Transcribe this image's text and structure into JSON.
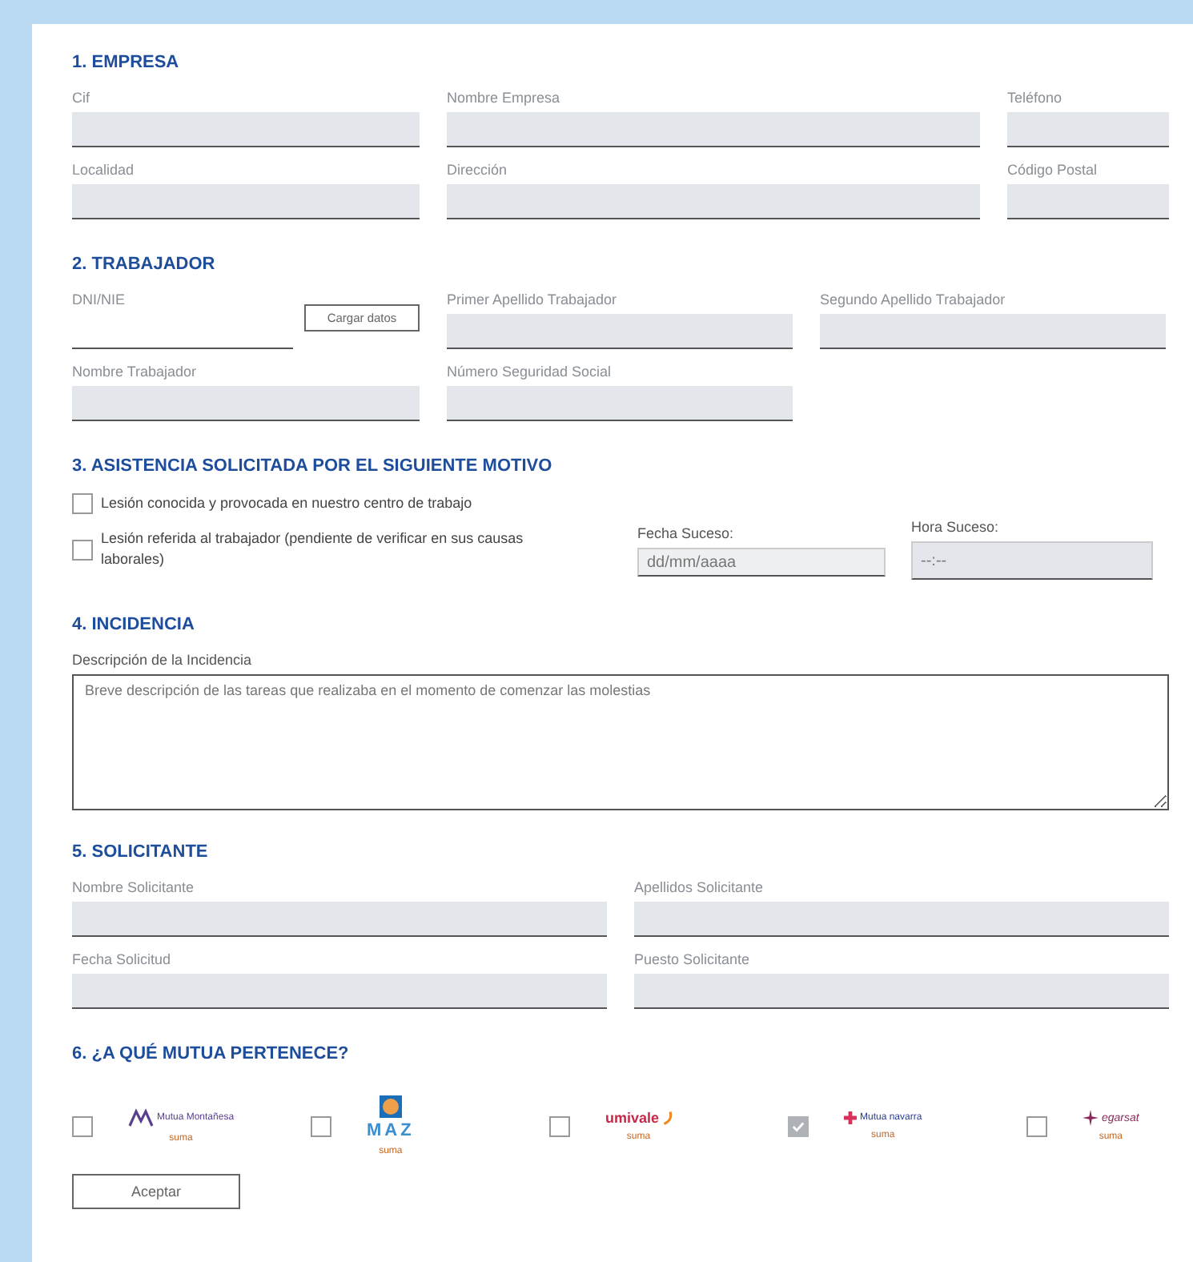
{
  "empresa": {
    "title": "1. EMPRESA",
    "fields": [
      {
        "label": "Cif"
      },
      {
        "label": "Nombre Empresa"
      },
      {
        "label": "Teléfono"
      },
      {
        "label": "Localidad"
      },
      {
        "label": "Dirección"
      },
      {
        "label": "Código Postal"
      }
    ]
  },
  "trabajador": {
    "title": "2. TRABAJADOR",
    "dni": {
      "label": "DNI/NIE",
      "button": "Cargar datos"
    },
    "fields": [
      {
        "label": "Primer Apellido Trabajador"
      },
      {
        "label": "Segundo Apellido Trabajador"
      },
      {
        "label": "Nombre Trabajador"
      },
      {
        "label": "Número Seguridad Social"
      }
    ]
  },
  "motivo": {
    "title": "3. ASISTENCIA SOLICITADA POR EL SIGUIENTE MOTIVO",
    "options": [
      {
        "label": "Lesión conocida y provocada en nuestro centro de trabajo",
        "checked": false
      },
      {
        "label": "Lesión referida al trabajador (pendiente de verificar en sus causas laborales)",
        "checked": false
      }
    ],
    "fecha": {
      "label": "Fecha Suceso:",
      "placeholder": "dd/mm/aaaa"
    },
    "hora": {
      "label": "Hora Suceso:",
      "placeholder": "--:--"
    }
  },
  "incidencia": {
    "title": "4. INCIDENCIA",
    "label": "Descripción de la Incidencia",
    "placeholder": "Breve descripción de las tareas que realizaba en el momento de comenzar las molestias"
  },
  "solicitante": {
    "title": "5. SOLICITANTE",
    "fields": [
      {
        "label": "Nombre Solicitante"
      },
      {
        "label": "Apellidos Solicitante"
      },
      {
        "label": "Fecha Solicitud"
      },
      {
        "label": "Puesto Solicitante"
      }
    ]
  },
  "mutua": {
    "title": "6. ¿A QUÉ MUTUA PERTENECE?",
    "options": [
      {
        "kind": "montanesa",
        "name": "Mutua Montañesa",
        "sub": "suma",
        "checked": false
      },
      {
        "kind": "maz",
        "name": "MAZ",
        "sub": "suma",
        "checked": false
      },
      {
        "kind": "umivale",
        "name": "umivale",
        "sub": "suma",
        "checked": false
      },
      {
        "kind": "navarra",
        "name": "Mutua navarra",
        "sub": "suma",
        "checked": true
      },
      {
        "kind": "egarsat",
        "name": "egarsat",
        "sub": "suma",
        "checked": false
      }
    ],
    "button": "Aceptar"
  }
}
